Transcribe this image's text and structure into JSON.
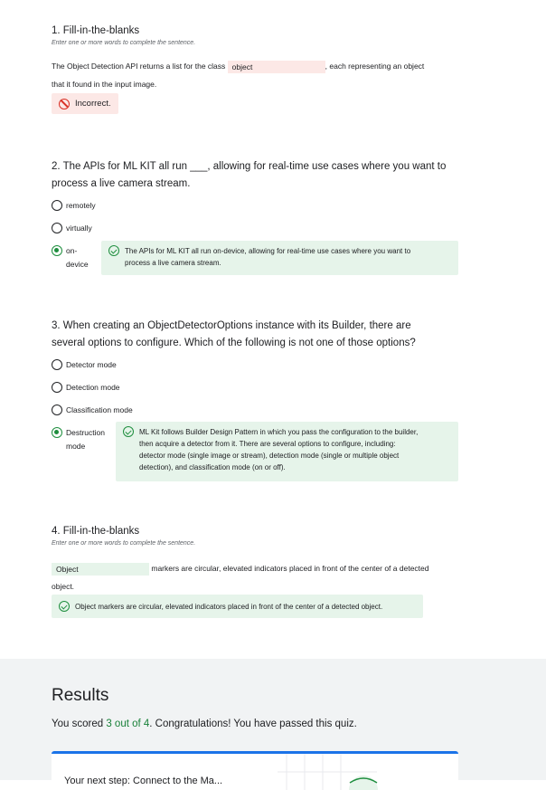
{
  "q1": {
    "title": "1. Fill-in-the-blanks",
    "instruction": "Enter one or more words to complete the sentence.",
    "sentence_before": "The Object Detection API returns a list for the class",
    "answer": "object",
    "sentence_after": ", each representing an object",
    "sentence_line2": "that it found in the input image.",
    "feedback": "Incorrect."
  },
  "q2": {
    "title_line1": "2. The APIs for ML KIT all run ___, allowing for real-time use cases where you want to",
    "title_line2": "process a live camera stream.",
    "options": [
      "remotely",
      "virtually"
    ],
    "selected_line1": "on-",
    "selected_line2": "device",
    "feedback_line1": "The APIs for ML KIT all run on-device, allowing for real-time use cases where you want to",
    "feedback_line2": "process a live camera stream."
  },
  "q3": {
    "title_line1": "3. When creating an ObjectDetectorOptions instance with its Builder, there are",
    "title_line2": "several options to configure. Which of the following is not one of those options?",
    "options": [
      "Detector mode",
      "Detection mode",
      "Classification mode"
    ],
    "selected_line1": "Destruction",
    "selected_line2": "mode",
    "feedback_lines": [
      "ML Kit follows Builder Design Pattern in which you pass the configuration to the builder,",
      "then acquire a detector from it. There are several options to configure, including:",
      "detector mode (single image or stream), detection mode (single or multiple object",
      "detection), and classification mode (on or off)."
    ]
  },
  "q4": {
    "title": "4. Fill-in-the-blanks",
    "instruction": "Enter one or more words to complete the sentence.",
    "answer": "Object",
    "sentence_after": "markers are circular, elevated indicators placed in front of the center of a detected",
    "sentence_line2": "object.",
    "feedback": "Object markers are circular, elevated indicators placed in front of the center of a detected object."
  },
  "results": {
    "title": "Results",
    "prefix": "You scored ",
    "score": "3 out of 4",
    "suffix": ". Congratulations! You have passed this quiz.",
    "card_text": "Your next step: Connect to the Ma..."
  },
  "colors": {
    "correct": "#1e8e3e",
    "incorrect": "#d93025",
    "accent": "#1a73e8"
  }
}
